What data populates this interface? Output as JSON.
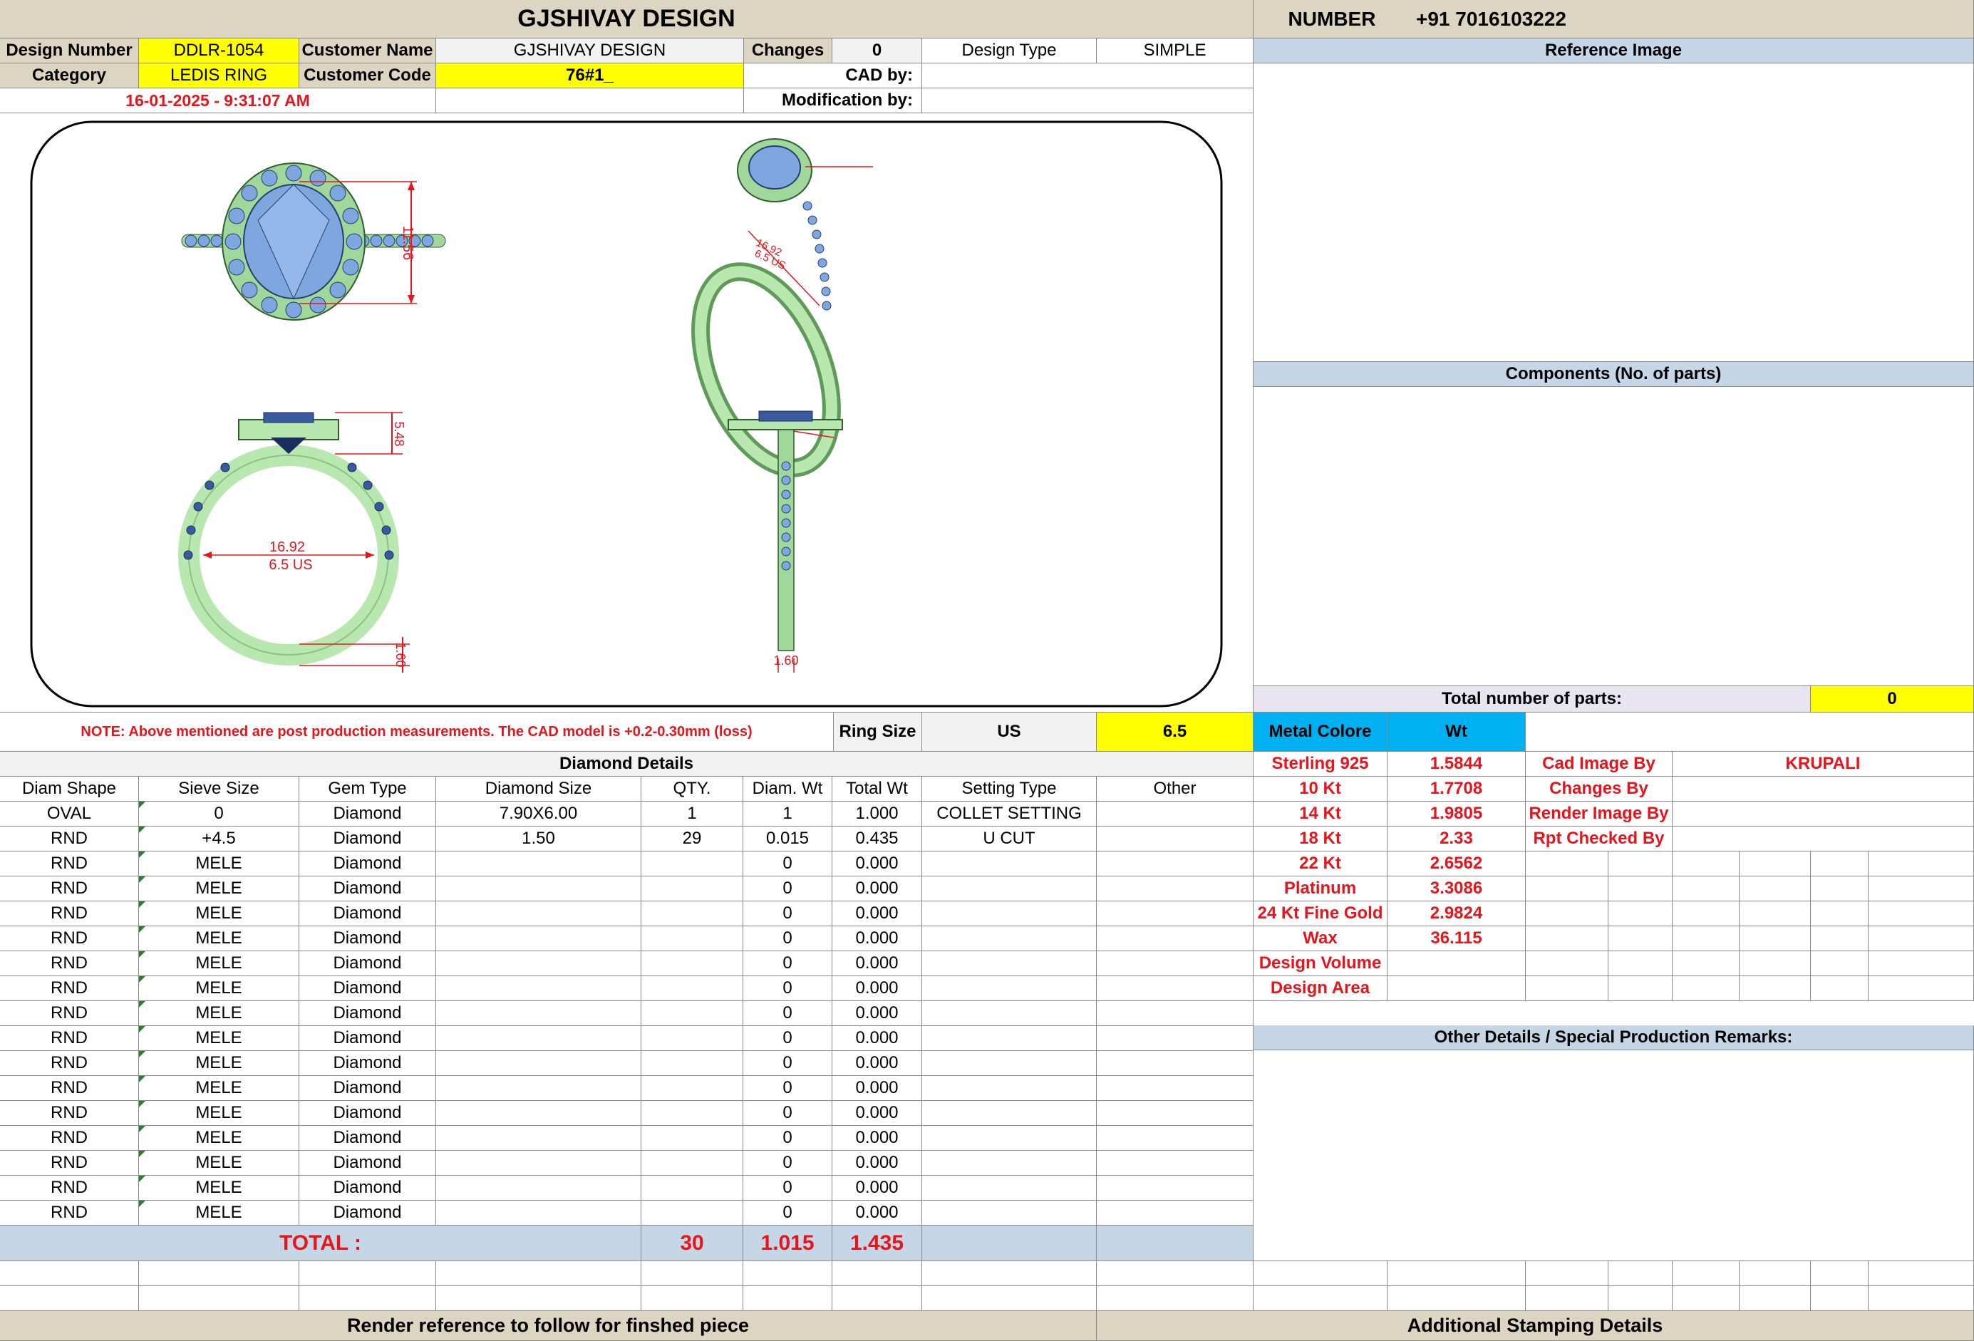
{
  "header": {
    "title": "GJSHIVAY DESIGN",
    "number_label": "NUMBER",
    "number_value": "+91 7016103222"
  },
  "info": {
    "design_number_label": "Design Number",
    "design_number": "DDLR-1054",
    "customer_name_label": "Customer Name",
    "customer_name": "GJSHIVAY DESIGN",
    "changes_label": "Changes",
    "changes": "0",
    "design_type_label": "Design Type",
    "design_type": "SIMPLE",
    "category_label": "Category",
    "category": "LEDIS RING",
    "customer_code_label": "Customer Code",
    "customer_code": "76#1_",
    "cad_by_label": "CAD by:",
    "cad_by": "",
    "timestamp": "16-01-2025 - 9:31:07 AM",
    "modification_by_label": "Modification by:",
    "modification_by": ""
  },
  "drawing": {
    "top_height": "11.56",
    "side_height": "5.48",
    "inner_diameter": "16.92",
    "ring_size_us": "6.5 US",
    "shank_width": "1.60",
    "profile_width": "1.60"
  },
  "right_panel": {
    "reference_image": "Reference Image",
    "components": "Components (No. of parts)",
    "total_parts_label": "Total number of parts:",
    "total_parts": "0",
    "metal_color_label": "Metal Colore",
    "wt_label": "Wt",
    "other_details": "Other Details / Special Production Remarks:"
  },
  "note": "NOTE: Above mentioned are post production measurements. The CAD model is +0.2-0.30mm (loss)",
  "ring_size": {
    "label": "Ring Size",
    "system": "US",
    "value": "6.5"
  },
  "diamond_details": {
    "title": "Diamond Details",
    "columns": [
      "Diam Shape",
      "Sieve Size",
      "Gem Type",
      "Diamond Size",
      "QTY.",
      "Diam. Wt",
      "Total Wt",
      "Setting Type",
      "Other"
    ],
    "rows": [
      [
        "OVAL",
        "0",
        "Diamond",
        "7.90X6.00",
        "1",
        "1",
        "1.000",
        "COLLET SETTING",
        ""
      ],
      [
        "RND",
        "+4.5",
        "Diamond",
        "1.50",
        "29",
        "0.015",
        "0.435",
        "U CUT",
        ""
      ],
      [
        "RND",
        "MELE",
        "Diamond",
        "",
        "",
        "0",
        "0.000",
        "",
        ""
      ],
      [
        "RND",
        "MELE",
        "Diamond",
        "",
        "",
        "0",
        "0.000",
        "",
        ""
      ],
      [
        "RND",
        "MELE",
        "Diamond",
        "",
        "",
        "0",
        "0.000",
        "",
        ""
      ],
      [
        "RND",
        "MELE",
        "Diamond",
        "",
        "",
        "0",
        "0.000",
        "",
        ""
      ],
      [
        "RND",
        "MELE",
        "Diamond",
        "",
        "",
        "0",
        "0.000",
        "",
        ""
      ],
      [
        "RND",
        "MELE",
        "Diamond",
        "",
        "",
        "0",
        "0.000",
        "",
        ""
      ],
      [
        "RND",
        "MELE",
        "Diamond",
        "",
        "",
        "0",
        "0.000",
        "",
        ""
      ],
      [
        "RND",
        "MELE",
        "Diamond",
        "",
        "",
        "0",
        "0.000",
        "",
        ""
      ],
      [
        "RND",
        "MELE",
        "Diamond",
        "",
        "",
        "0",
        "0.000",
        "",
        ""
      ],
      [
        "RND",
        "MELE",
        "Diamond",
        "",
        "",
        "0",
        "0.000",
        "",
        ""
      ],
      [
        "RND",
        "MELE",
        "Diamond",
        "",
        "",
        "0",
        "0.000",
        "",
        ""
      ],
      [
        "RND",
        "MELE",
        "Diamond",
        "",
        "",
        "0",
        "0.000",
        "",
        ""
      ],
      [
        "RND",
        "MELE",
        "Diamond",
        "",
        "",
        "0",
        "0.000",
        "",
        ""
      ],
      [
        "RND",
        "MELE",
        "Diamond",
        "",
        "",
        "0",
        "0.000",
        "",
        ""
      ],
      [
        "RND",
        "MELE",
        "Diamond",
        "",
        "",
        "0",
        "0.000",
        "",
        ""
      ]
    ],
    "total_label": "TOTAL :",
    "total_qty": "30",
    "total_diam_wt": "1.015",
    "total_wt": "1.435"
  },
  "metals": [
    {
      "name": "Sterling 925",
      "wt": "1.5844"
    },
    {
      "name": "10 Kt",
      "wt": "1.7708"
    },
    {
      "name": "14 Kt",
      "wt": "1.9805"
    },
    {
      "name": "18 Kt",
      "wt": "2.33"
    },
    {
      "name": "22 Kt",
      "wt": "2.6562"
    },
    {
      "name": "Platinum",
      "wt": "3.3086"
    },
    {
      "name": "24 Kt Fine Gold",
      "wt": "2.9824"
    },
    {
      "name": "Wax",
      "wt": "36.115"
    },
    {
      "name": "Design Volume",
      "wt": ""
    },
    {
      "name": "Design Area",
      "wt": ""
    }
  ],
  "credits": [
    {
      "label": "Cad Image By",
      "value": "KRUPALI"
    },
    {
      "label": "Changes By",
      "value": ""
    },
    {
      "label": "Render Image By",
      "value": ""
    },
    {
      "label": "Rpt Checked By",
      "value": ""
    }
  ],
  "footer": {
    "render_reference": "Render reference to follow for finshed piece",
    "stamping": "Additional Stamping Details"
  },
  "colors": {
    "header_bg": "#dcd5c2",
    "section_blue": "#c5d6e6",
    "highlight_yellow": "#ffff00",
    "metal_cyan": "#00b0f0",
    "red_text": "#e8141b",
    "metal_green": "#a8e6a0",
    "gem_blue": "#7ea7e0"
  }
}
